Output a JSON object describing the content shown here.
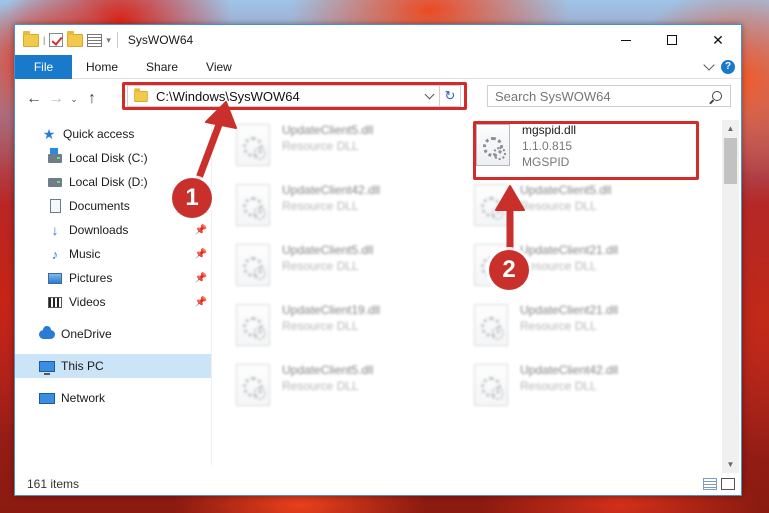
{
  "window": {
    "title": "SysWOW64",
    "controls": {
      "minimize": "—",
      "maximize": "☐",
      "close": "✕"
    }
  },
  "ribbon": {
    "tabs": [
      "File",
      "Home",
      "Share",
      "View"
    ],
    "help": "?"
  },
  "nav": {
    "back": "←",
    "forward": "→",
    "recent": "⌄",
    "up": "↑"
  },
  "address": {
    "path": "C:\\Windows\\SysWOW64",
    "refresh": "↻"
  },
  "search": {
    "placeholder": "Search SysWOW64"
  },
  "sidebar": {
    "items": [
      {
        "label": "Quick access",
        "icon": "star-icon",
        "pinned": false
      },
      {
        "label": "Local Disk (C:)",
        "icon": "windows-disk-icon",
        "pinned": false
      },
      {
        "label": "Local Disk (D:)",
        "icon": "disk-icon",
        "pinned": false
      },
      {
        "label": "Documents",
        "icon": "document-icon",
        "pinned": false
      },
      {
        "label": "Downloads",
        "icon": "download-icon",
        "pinned": true
      },
      {
        "label": "Music",
        "icon": "music-icon",
        "pinned": true
      },
      {
        "label": "Pictures",
        "icon": "pictures-icon",
        "pinned": true
      },
      {
        "label": "Videos",
        "icon": "video-icon",
        "pinned": true
      },
      {
        "label": "OneDrive",
        "icon": "onedrive-icon",
        "pinned": false
      },
      {
        "label": "This PC",
        "icon": "this-pc-icon",
        "pinned": false,
        "selected": true
      },
      {
        "label": "Network",
        "icon": "network-icon",
        "pinned": false
      }
    ]
  },
  "files": {
    "left": [
      {
        "name": "UpdateClient5.dll",
        "type": "Resource DLL"
      },
      {
        "name": "UpdateClient42.dll",
        "type": "Resource DLL"
      },
      {
        "name": "UpdateClient5.dll",
        "type": "Resource DLL"
      },
      {
        "name": "UpdateClient19.dll",
        "type": "Resource DLL"
      },
      {
        "name": "UpdateClient5.dll",
        "type": "Resource DLL"
      }
    ],
    "right": [
      {
        "name": "mgspid.dll",
        "version": "1.1.0.815",
        "product": "MGSPID",
        "highlighted": true
      },
      {
        "name": "UpdateClient5.dll",
        "type": "Resource DLL"
      },
      {
        "name": "UpdateClient21.dll",
        "type": "Resource DLL"
      },
      {
        "name": "UpdateClient21.dll",
        "type": "Resource DLL"
      },
      {
        "name": "UpdateClient42.dll",
        "type": "Resource DLL"
      }
    ]
  },
  "status": {
    "item_count": "161 items"
  },
  "annotations": {
    "step1": "1",
    "step2": "2",
    "color": "#c9302c"
  },
  "colors": {
    "accent": "#1979ca",
    "selection": "#cce4f7",
    "highlight_border": "#d42a28"
  }
}
